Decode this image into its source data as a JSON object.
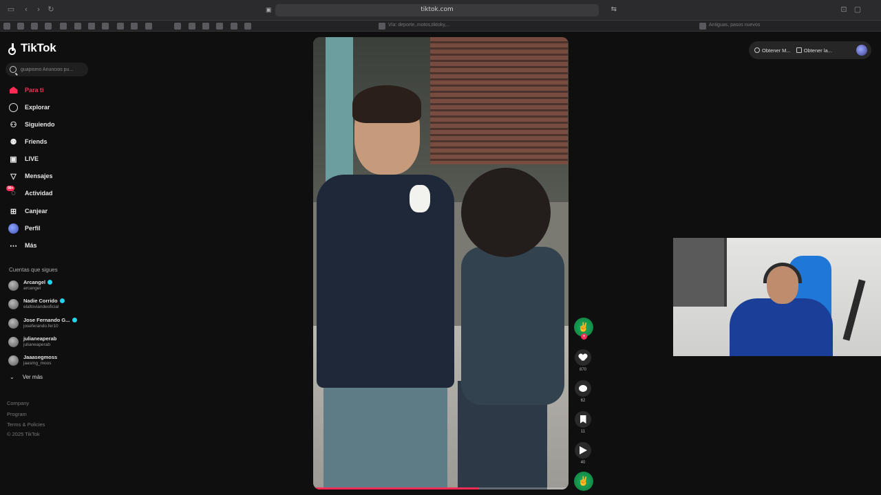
{
  "browser": {
    "url": "tiktok.com",
    "toolbar_hint_center": "Vía: deporte,.motos,tiktoky,...",
    "toolbar_hint_right": "Antiguas, pasos nuevos"
  },
  "sidebar": {
    "logo": "TikTok",
    "search_placeholder": "guapismo Anuncios pu...",
    "nav": [
      {
        "label": "Para ti",
        "icon": "home-icon"
      },
      {
        "label": "Explorar",
        "icon": "compass-icon"
      },
      {
        "label": "Siguiendo",
        "icon": "following-icon"
      },
      {
        "label": "Friends",
        "icon": "friends-icon"
      },
      {
        "label": "LIVE",
        "icon": "live-icon"
      },
      {
        "label": "Mensajes",
        "icon": "messages-icon"
      },
      {
        "label": "Actividad",
        "icon": "activity-icon",
        "badge": "99+"
      },
      {
        "label": "Canjear",
        "icon": "redeem-icon"
      },
      {
        "label": "Perfil",
        "icon": "profile-icon"
      },
      {
        "label": "Más",
        "icon": "more-icon"
      }
    ],
    "following_title": "Cuentas que sigues",
    "following": [
      {
        "name": "Arcangel",
        "handle": "arcangel",
        "verified": true
      },
      {
        "name": "Nadie Corrido",
        "handle": "elaltoviandeoficial",
        "verified": true
      },
      {
        "name": "Jose Fernando G...",
        "handle": "joseferando.fer10",
        "verified": true
      },
      {
        "name": "julianeaperab",
        "handle": "julianeaperab",
        "verified": false
      },
      {
        "name": "Jaaasegmoss",
        "handle": "jaasmg_moos",
        "verified": false
      }
    ],
    "see_more": "Ver más",
    "footer": [
      "Company",
      "Program",
      "Terms & Policies",
      "© 2025 TikTok"
    ]
  },
  "video": {
    "progress": 0.65
  },
  "actions": {
    "likes": "870",
    "comments": "62",
    "saves": "11",
    "shares": "40"
  },
  "extension": {
    "btn1": "Obtener M...",
    "btn2": "Obtener la..."
  },
  "colors": {
    "accent": "#fe2c55",
    "background": "#0f0f0f"
  }
}
